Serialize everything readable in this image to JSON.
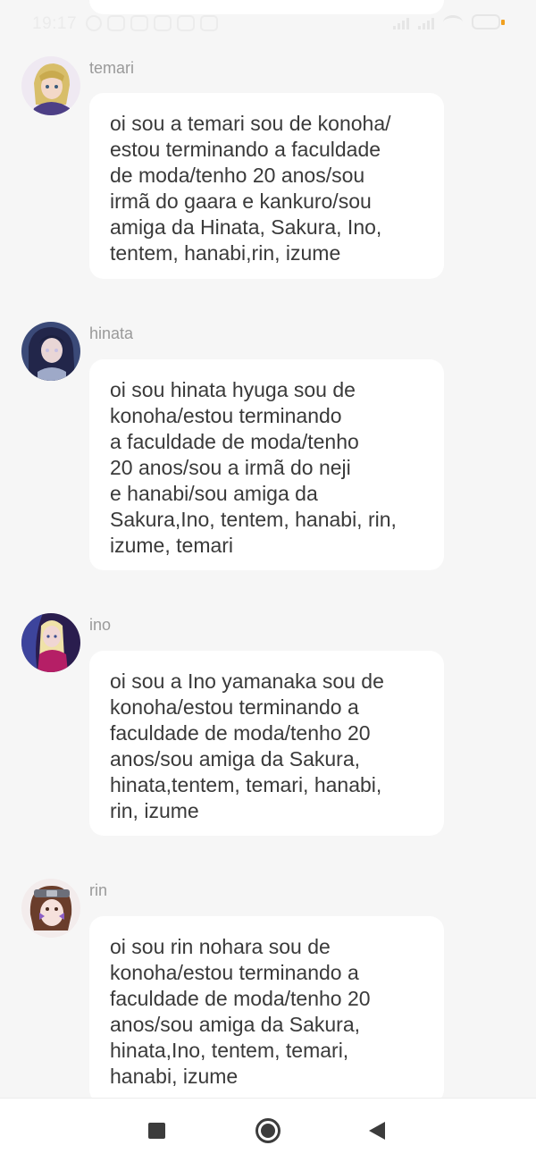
{
  "status_bar": {
    "time": "19:17",
    "notification_icons": [
      "alarm-icon",
      "chat-icon",
      "chat-icon",
      "chat-icon",
      "chat-icon",
      "chat-icon"
    ],
    "right_icons": [
      "signal-icon",
      "signal-icon",
      "wifi-icon",
      "battery-icon"
    ]
  },
  "posts": [
    {
      "username": "temari",
      "avatar_icon": "temari-avatar",
      "lines": [
        "oi sou a temari sou de konoha/",
        "estou terminando a faculdade",
        "de moda/tenho 20 anos/sou",
        "irmã do gaara e kankuro/sou",
        "amiga da Hinata, Sakura, Ino,",
        "tentem, hanabi,rin, izume"
      ]
    },
    {
      "username": "hinata",
      "avatar_icon": "hinata-avatar",
      "lines": [
        "oi sou hinata hyuga sou de",
        "konoha/estou terminando",
        "a faculdade de moda/tenho",
        "20 anos/sou a irmã do neji",
        "e hanabi/sou amiga da",
        "Sakura,Ino, tentem, hanabi, rin,",
        "izume, temari"
      ]
    },
    {
      "username": "ino",
      "avatar_icon": "ino-avatar",
      "lines": [
        "oi sou a Ino yamanaka sou de",
        "konoha/estou terminando a",
        "faculdade de moda/tenho 20",
        "anos/sou amiga da Sakura,",
        "hinata,tentem, temari, hanabi,",
        "rin, izume"
      ]
    },
    {
      "username": "rin",
      "avatar_icon": "rin-avatar",
      "lines": [
        "oi sou rin nohara sou de",
        "konoha/estou terminando a",
        "faculdade de moda/tenho 20",
        "anos/sou amiga da Sakura,",
        "hinata,Ino, tentem, temari,",
        "hanabi, izume"
      ]
    }
  ],
  "nav_bar": {
    "icons": [
      "recents-icon",
      "home-icon",
      "back-icon"
    ]
  }
}
